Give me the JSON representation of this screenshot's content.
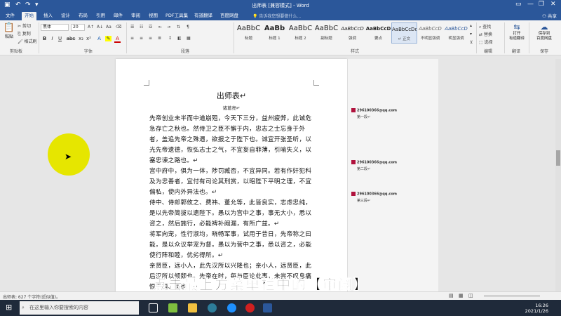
{
  "window": {
    "title": "出师表 [兼容模式] - Word"
  },
  "tabs": [
    "文件",
    "开始",
    "插入",
    "设计",
    "布局",
    "引用",
    "邮件",
    "审阅",
    "视图",
    "PDF工具集",
    "有道翻译",
    "百度网盘"
  ],
  "tell_me": "告诉我您想要做什么...",
  "share": "共享",
  "ribbon": {
    "clipboard": {
      "paste": "粘贴",
      "cut": "剪切",
      "copy": "复制",
      "format_painter": "格式刷",
      "label": "剪贴板"
    },
    "font": {
      "name": "黑体",
      "size": "20",
      "label": "字体",
      "bold": "B",
      "italic": "I",
      "underline": "U",
      "strike": "abc",
      "subscript": "x₂",
      "superscript": "x²",
      "clear": "A",
      "color": "A"
    },
    "paragraph": {
      "label": "段落"
    },
    "styles": {
      "label": "样式",
      "items": [
        {
          "preview": "AaBbC",
          "name": "标题"
        },
        {
          "preview": "AaBb",
          "name": "标题 1"
        },
        {
          "preview": "AaBbC",
          "name": "标题 2"
        },
        {
          "preview": "AaBbC",
          "name": "副标题"
        },
        {
          "preview": "AaBbCcD",
          "name": "强调"
        },
        {
          "preview": "AaBbCcD",
          "name": "要点"
        },
        {
          "preview": "AaBbCcDd",
          "name": "↵ 正文"
        },
        {
          "preview": "AaBbCcD",
          "name": "不明显强调"
        },
        {
          "preview": "AaBbCcD",
          "name": "明显强调"
        }
      ]
    },
    "editing": {
      "find": "查找",
      "replace": "替换",
      "select": "选择",
      "label": "编辑"
    },
    "translate": {
      "label": "打开\n有道翻译",
      "group": "翻译"
    },
    "baidu": {
      "label": "保存到\n百度网盘",
      "group": "保存"
    }
  },
  "document": {
    "title": "出师表↵",
    "author": "诸葛亮↵",
    "paragraphs": [
      "先帝创业未半而中道崩殂，今天下三分，益州疲弊，此诚危急存亡之秋也。然侍卫之臣不懈于内，忠志之士忘身于外者，盖追先帝之殊遇，欲报之于陛下也。诚宜开张圣听，以光先帝遗德，恢弘志士之气，不宜妄自菲薄，引喻失义，以塞忠谏之路也。↵",
      "宫中府中，俱为一体，陟罚臧否，不宜异同。若有作奸犯科及为忠善者，宜付有司论其刑赏，以昭陛下平明之理，不宜偏私，使内外异法也。↵",
      "侍中、侍郎郭攸之、费祎、董允等，此皆良实，志虑忠纯，是以先帝简拔以遗陛下。愚以为宫中之事，事无大小，悉以咨之，然后施行，必能裨补阙漏，有所广益。↵",
      "将军向宠，性行淑均，晓畅军事，试用于昔日，先帝称之曰能，是以众议举宠为督。愚以为营中之事，悉以咨之，必能使行阵和睦，优劣得所。↵",
      "亲贤臣，远小人，此先汉所以兴隆也；亲小人，远贤臣，此后汉所以倾颓也。先帝在时，每与臣论此事，未尝不叹息痛恨于桓、灵也。↵"
    ]
  },
  "comments": [
    {
      "author": "296100366@qq.com",
      "text": "第一段↵"
    },
    {
      "author": "296100366@qq.com",
      "text": "第二段↵"
    },
    {
      "author": "296100366@qq.com",
      "text": "第三段↵"
    }
  ],
  "caption": "点击最上方菜单栏中的【审阅】",
  "status": {
    "words": "出师表: 627 个字符(近似值)。"
  },
  "taskbar": {
    "search_placeholder": "在这里输入你要搜索的内容",
    "time": "16:26",
    "date": "2021/1/26"
  },
  "colors": {
    "accent": "#2b579a",
    "comment_badge": "#b0123d",
    "cursor_highlight": "#e6e600"
  }
}
